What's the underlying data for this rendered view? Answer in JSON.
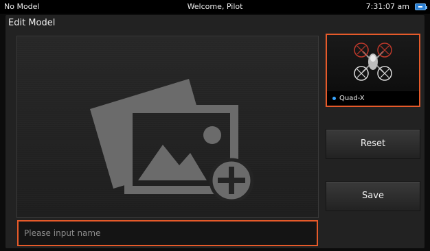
{
  "status_bar": {
    "left_text": "No Model",
    "center_text": "Welcome, Pilot",
    "time": "7:31:07 am",
    "battery_icon": "battery-icon"
  },
  "panel": {
    "title": "Edit Model"
  },
  "image_area": {
    "icon": "add-photo-icon"
  },
  "name_input": {
    "placeholder": "Please input name",
    "value": ""
  },
  "model_card": {
    "icon": "quadcopter-icon",
    "name": "Quad-X",
    "indicator_color": "#3aa6ff"
  },
  "buttons": {
    "reset_label": "Reset",
    "save_label": "Save"
  },
  "colors": {
    "highlight": "#e65a2a",
    "panel_bg": "#222222",
    "rotor_red": "#c0392b"
  }
}
